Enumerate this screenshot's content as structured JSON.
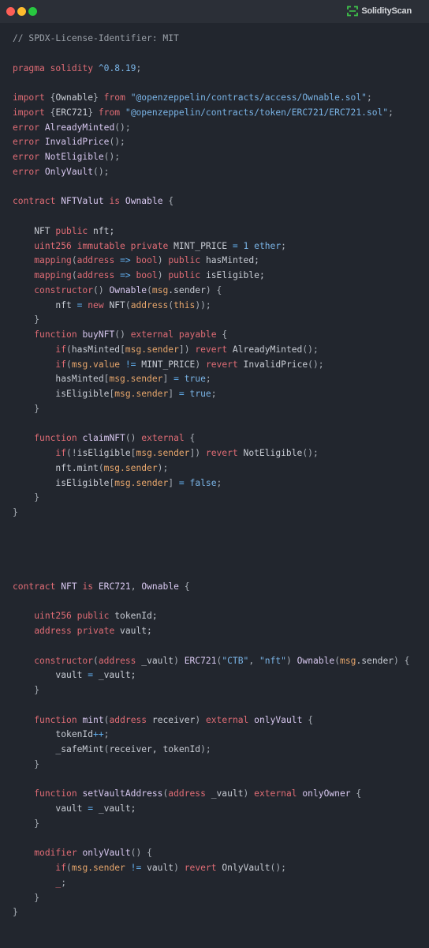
{
  "window": {
    "controls": [
      "close",
      "minimize",
      "maximize"
    ],
    "brand": {
      "name": "SolidityScan",
      "icon": "scan-frame-icon",
      "accent": "#3fc24a"
    }
  },
  "editor": {
    "language": "solidity",
    "lines": [
      [
        [
          "comment",
          "// SPDX-License-Identifier: MIT"
        ]
      ],
      [],
      [
        [
          "kw",
          "pragma"
        ],
        [
          "plain",
          " "
        ],
        [
          "kw",
          "solidity"
        ],
        [
          "plain",
          " "
        ],
        [
          "num",
          "^0.8.19"
        ],
        [
          "punc",
          ";"
        ]
      ],
      [],
      [
        [
          "kw",
          "import"
        ],
        [
          "plain",
          " "
        ],
        [
          "punc",
          "{"
        ],
        [
          "plain",
          "Ownable"
        ],
        [
          "punc",
          "}"
        ],
        [
          "plain",
          " "
        ],
        [
          "kw",
          "from"
        ],
        [
          "plain",
          " "
        ],
        [
          "str",
          "\"@openzeppelin/contracts/access/Ownable.sol\""
        ],
        [
          "punc",
          ";"
        ]
      ],
      [
        [
          "kw",
          "import"
        ],
        [
          "plain",
          " "
        ],
        [
          "punc",
          "{"
        ],
        [
          "plain",
          "ERC721"
        ],
        [
          "punc",
          "}"
        ],
        [
          "plain",
          " "
        ],
        [
          "kw",
          "from"
        ],
        [
          "plain",
          " "
        ],
        [
          "str",
          "\"@openzeppelin/contracts/token/ERC721/ERC721.sol\""
        ],
        [
          "punc",
          ";"
        ]
      ],
      [
        [
          "kw",
          "error"
        ],
        [
          "plain",
          " "
        ],
        [
          "def",
          "AlreadyMinted"
        ],
        [
          "punc",
          "();"
        ]
      ],
      [
        [
          "kw",
          "error"
        ],
        [
          "plain",
          " "
        ],
        [
          "def",
          "InvalidPrice"
        ],
        [
          "punc",
          "();"
        ]
      ],
      [
        [
          "kw",
          "error"
        ],
        [
          "plain",
          " "
        ],
        [
          "def",
          "NotEligible"
        ],
        [
          "punc",
          "();"
        ]
      ],
      [
        [
          "kw",
          "error"
        ],
        [
          "plain",
          " "
        ],
        [
          "def",
          "OnlyVault"
        ],
        [
          "punc",
          "();"
        ]
      ],
      [],
      [
        [
          "kw",
          "contract"
        ],
        [
          "plain",
          " "
        ],
        [
          "def",
          "NFTValut"
        ],
        [
          "plain",
          " "
        ],
        [
          "kw",
          "is"
        ],
        [
          "plain",
          " "
        ],
        [
          "def",
          "Ownable"
        ],
        [
          "plain",
          " "
        ],
        [
          "punc",
          "{"
        ]
      ],
      [],
      [
        [
          "plain",
          "    NFT "
        ],
        [
          "kw",
          "public"
        ],
        [
          "plain",
          " nft;"
        ]
      ],
      [
        [
          "plain",
          "    "
        ],
        [
          "kw",
          "uint256"
        ],
        [
          "plain",
          " "
        ],
        [
          "kw",
          "immutable"
        ],
        [
          "plain",
          " "
        ],
        [
          "kw",
          "private"
        ],
        [
          "plain",
          " MINT_PRICE "
        ],
        [
          "op",
          "="
        ],
        [
          "plain",
          " "
        ],
        [
          "num",
          "1"
        ],
        [
          "plain",
          " "
        ],
        [
          "num",
          "ether"
        ],
        [
          "punc",
          ";"
        ]
      ],
      [
        [
          "plain",
          "    "
        ],
        [
          "kw",
          "mapping"
        ],
        [
          "punc",
          "("
        ],
        [
          "kw",
          "address"
        ],
        [
          "plain",
          " "
        ],
        [
          "op",
          "=>"
        ],
        [
          "plain",
          " "
        ],
        [
          "kw",
          "bool"
        ],
        [
          "punc",
          ")"
        ],
        [
          "plain",
          " "
        ],
        [
          "kw",
          "public"
        ],
        [
          "plain",
          " hasMinted;"
        ]
      ],
      [
        [
          "plain",
          "    "
        ],
        [
          "kw",
          "mapping"
        ],
        [
          "punc",
          "("
        ],
        [
          "kw",
          "address"
        ],
        [
          "plain",
          " "
        ],
        [
          "op",
          "=>"
        ],
        [
          "plain",
          " "
        ],
        [
          "kw",
          "bool"
        ],
        [
          "punc",
          ")"
        ],
        [
          "plain",
          " "
        ],
        [
          "kw",
          "public"
        ],
        [
          "plain",
          " isEligible;"
        ]
      ],
      [
        [
          "plain",
          "    "
        ],
        [
          "kw",
          "constructor"
        ],
        [
          "punc",
          "()"
        ],
        [
          "plain",
          " "
        ],
        [
          "def",
          "Ownable"
        ],
        [
          "punc",
          "("
        ],
        [
          "msg",
          "msg"
        ],
        [
          "plain",
          ".sender"
        ],
        [
          "punc",
          ")"
        ],
        [
          "plain",
          " "
        ],
        [
          "punc",
          "{"
        ]
      ],
      [
        [
          "plain",
          "        nft "
        ],
        [
          "op",
          "="
        ],
        [
          "plain",
          " "
        ],
        [
          "kw",
          "new"
        ],
        [
          "plain",
          " NFT"
        ],
        [
          "punc",
          "("
        ],
        [
          "msg",
          "address"
        ],
        [
          "punc",
          "("
        ],
        [
          "msg",
          "this"
        ],
        [
          "punc",
          "));"
        ]
      ],
      [
        [
          "punc",
          "    }"
        ]
      ],
      [
        [
          "plain",
          "    "
        ],
        [
          "kw",
          "function"
        ],
        [
          "plain",
          " "
        ],
        [
          "def",
          "buyNFT"
        ],
        [
          "punc",
          "()"
        ],
        [
          "plain",
          " "
        ],
        [
          "kw",
          "external"
        ],
        [
          "plain",
          " "
        ],
        [
          "kw",
          "payable"
        ],
        [
          "plain",
          " "
        ],
        [
          "punc",
          "{"
        ]
      ],
      [
        [
          "plain",
          "        "
        ],
        [
          "kw",
          "if"
        ],
        [
          "punc",
          "("
        ],
        [
          "plain",
          "hasMinted"
        ],
        [
          "punc",
          "["
        ],
        [
          "msg",
          "msg.sender"
        ],
        [
          "punc",
          "])"
        ],
        [
          "plain",
          " "
        ],
        [
          "kw",
          "revert"
        ],
        [
          "plain",
          " AlreadyMinted"
        ],
        [
          "punc",
          "();"
        ]
      ],
      [
        [
          "plain",
          "        "
        ],
        [
          "kw",
          "if"
        ],
        [
          "punc",
          "("
        ],
        [
          "msg",
          "msg.value"
        ],
        [
          "plain",
          " "
        ],
        [
          "op",
          "!="
        ],
        [
          "plain",
          " MINT_PRICE"
        ],
        [
          "punc",
          ")"
        ],
        [
          "plain",
          " "
        ],
        [
          "kw",
          "revert"
        ],
        [
          "plain",
          " InvalidPrice"
        ],
        [
          "punc",
          "();"
        ]
      ],
      [
        [
          "plain",
          "        hasMinted"
        ],
        [
          "punc",
          "["
        ],
        [
          "msg",
          "msg.sender"
        ],
        [
          "punc",
          "]"
        ],
        [
          "plain",
          " "
        ],
        [
          "op",
          "="
        ],
        [
          "plain",
          " "
        ],
        [
          "num",
          "true"
        ],
        [
          "punc",
          ";"
        ]
      ],
      [
        [
          "plain",
          "        isEligible"
        ],
        [
          "punc",
          "["
        ],
        [
          "msg",
          "msg.sender"
        ],
        [
          "punc",
          "]"
        ],
        [
          "plain",
          " "
        ],
        [
          "op",
          "="
        ],
        [
          "plain",
          " "
        ],
        [
          "num",
          "true"
        ],
        [
          "punc",
          ";"
        ]
      ],
      [
        [
          "punc",
          "    }"
        ]
      ],
      [],
      [
        [
          "plain",
          "    "
        ],
        [
          "kw",
          "function"
        ],
        [
          "plain",
          " "
        ],
        [
          "def",
          "claimNFT"
        ],
        [
          "punc",
          "()"
        ],
        [
          "plain",
          " "
        ],
        [
          "kw",
          "external"
        ],
        [
          "plain",
          " "
        ],
        [
          "punc",
          "{"
        ]
      ],
      [
        [
          "plain",
          "        "
        ],
        [
          "kw",
          "if"
        ],
        [
          "punc",
          "(!"
        ],
        [
          "plain",
          "isEligible"
        ],
        [
          "punc",
          "["
        ],
        [
          "msg",
          "msg.sender"
        ],
        [
          "punc",
          "])"
        ],
        [
          "plain",
          " "
        ],
        [
          "kw",
          "revert"
        ],
        [
          "plain",
          " NotEligible"
        ],
        [
          "punc",
          "();"
        ]
      ],
      [
        [
          "plain",
          "        nft.mint"
        ],
        [
          "punc",
          "("
        ],
        [
          "msg",
          "msg.sender"
        ],
        [
          "punc",
          ");"
        ]
      ],
      [
        [
          "plain",
          "        isEligible"
        ],
        [
          "punc",
          "["
        ],
        [
          "msg",
          "msg.sender"
        ],
        [
          "punc",
          "]"
        ],
        [
          "plain",
          " "
        ],
        [
          "op",
          "="
        ],
        [
          "plain",
          " "
        ],
        [
          "num",
          "false"
        ],
        [
          "punc",
          ";"
        ]
      ],
      [
        [
          "punc",
          "    }"
        ]
      ],
      [
        [
          "punc",
          "}"
        ]
      ],
      [],
      [],
      [],
      [],
      [
        [
          "kw",
          "contract"
        ],
        [
          "plain",
          " "
        ],
        [
          "def",
          "NFT"
        ],
        [
          "plain",
          " "
        ],
        [
          "kw",
          "is"
        ],
        [
          "plain",
          " "
        ],
        [
          "def",
          "ERC721"
        ],
        [
          "punc",
          ","
        ],
        [
          "plain",
          " "
        ],
        [
          "def",
          "Ownable"
        ],
        [
          "plain",
          " "
        ],
        [
          "punc",
          "{"
        ]
      ],
      [],
      [
        [
          "plain",
          "    "
        ],
        [
          "kw",
          "uint256"
        ],
        [
          "plain",
          " "
        ],
        [
          "kw",
          "public"
        ],
        [
          "plain",
          " tokenId;"
        ]
      ],
      [
        [
          "plain",
          "    "
        ],
        [
          "kw",
          "address"
        ],
        [
          "plain",
          " "
        ],
        [
          "kw",
          "private"
        ],
        [
          "plain",
          " vault;"
        ]
      ],
      [],
      [
        [
          "plain",
          "    "
        ],
        [
          "kw",
          "constructor"
        ],
        [
          "punc",
          "("
        ],
        [
          "kw",
          "address"
        ],
        [
          "plain",
          " _vault"
        ],
        [
          "punc",
          ")"
        ],
        [
          "plain",
          " "
        ],
        [
          "def",
          "ERC721"
        ],
        [
          "punc",
          "("
        ],
        [
          "str",
          "\"CTB\""
        ],
        [
          "punc",
          ","
        ],
        [
          "plain",
          " "
        ],
        [
          "str",
          "\"nft\""
        ],
        [
          "punc",
          ")"
        ],
        [
          "plain",
          " "
        ],
        [
          "def",
          "Ownable"
        ],
        [
          "punc",
          "("
        ],
        [
          "msg",
          "msg"
        ],
        [
          "plain",
          ".sender"
        ],
        [
          "punc",
          ")"
        ],
        [
          "plain",
          " "
        ],
        [
          "punc",
          "{"
        ]
      ],
      [
        [
          "plain",
          "        vault "
        ],
        [
          "op",
          "="
        ],
        [
          "plain",
          " _vault;"
        ]
      ],
      [
        [
          "punc",
          "    }"
        ]
      ],
      [],
      [
        [
          "plain",
          "    "
        ],
        [
          "kw",
          "function"
        ],
        [
          "plain",
          " "
        ],
        [
          "def",
          "mint"
        ],
        [
          "punc",
          "("
        ],
        [
          "kw",
          "address"
        ],
        [
          "plain",
          " receiver"
        ],
        [
          "punc",
          ")"
        ],
        [
          "plain",
          " "
        ],
        [
          "kw",
          "external"
        ],
        [
          "plain",
          " "
        ],
        [
          "def",
          "onlyVault"
        ],
        [
          "plain",
          " "
        ],
        [
          "punc",
          "{"
        ]
      ],
      [
        [
          "plain",
          "        tokenId"
        ],
        [
          "op",
          "++"
        ],
        [
          "punc",
          ";"
        ]
      ],
      [
        [
          "plain",
          "        _safeMint"
        ],
        [
          "punc",
          "("
        ],
        [
          "plain",
          "receiver, tokenId"
        ],
        [
          "punc",
          ");"
        ]
      ],
      [
        [
          "punc",
          "    }"
        ]
      ],
      [],
      [
        [
          "plain",
          "    "
        ],
        [
          "kw",
          "function"
        ],
        [
          "plain",
          " "
        ],
        [
          "def",
          "setVaultAddress"
        ],
        [
          "punc",
          "("
        ],
        [
          "kw",
          "address"
        ],
        [
          "plain",
          " _vault"
        ],
        [
          "punc",
          ")"
        ],
        [
          "plain",
          " "
        ],
        [
          "kw",
          "external"
        ],
        [
          "plain",
          " "
        ],
        [
          "def",
          "onlyOwner"
        ],
        [
          "plain",
          " "
        ],
        [
          "punc",
          "{"
        ]
      ],
      [
        [
          "plain",
          "        vault "
        ],
        [
          "op",
          "="
        ],
        [
          "plain",
          " _vault;"
        ]
      ],
      [
        [
          "punc",
          "    }"
        ]
      ],
      [],
      [
        [
          "plain",
          "    "
        ],
        [
          "kw",
          "modifier"
        ],
        [
          "plain",
          " "
        ],
        [
          "def",
          "onlyVault"
        ],
        [
          "punc",
          "()"
        ],
        [
          "plain",
          " "
        ],
        [
          "punc",
          "{"
        ]
      ],
      [
        [
          "plain",
          "        "
        ],
        [
          "kw",
          "if"
        ],
        [
          "punc",
          "("
        ],
        [
          "msg",
          "msg.sender"
        ],
        [
          "plain",
          " "
        ],
        [
          "op",
          "!="
        ],
        [
          "plain",
          " vault"
        ],
        [
          "punc",
          ")"
        ],
        [
          "plain",
          " "
        ],
        [
          "kw",
          "revert"
        ],
        [
          "plain",
          " OnlyVault"
        ],
        [
          "punc",
          "();"
        ]
      ],
      [
        [
          "plain",
          "        "
        ],
        [
          "kw",
          "_"
        ],
        [
          "punc",
          ";"
        ]
      ],
      [
        [
          "punc",
          "    }"
        ]
      ],
      [
        [
          "punc",
          "}"
        ]
      ]
    ]
  }
}
